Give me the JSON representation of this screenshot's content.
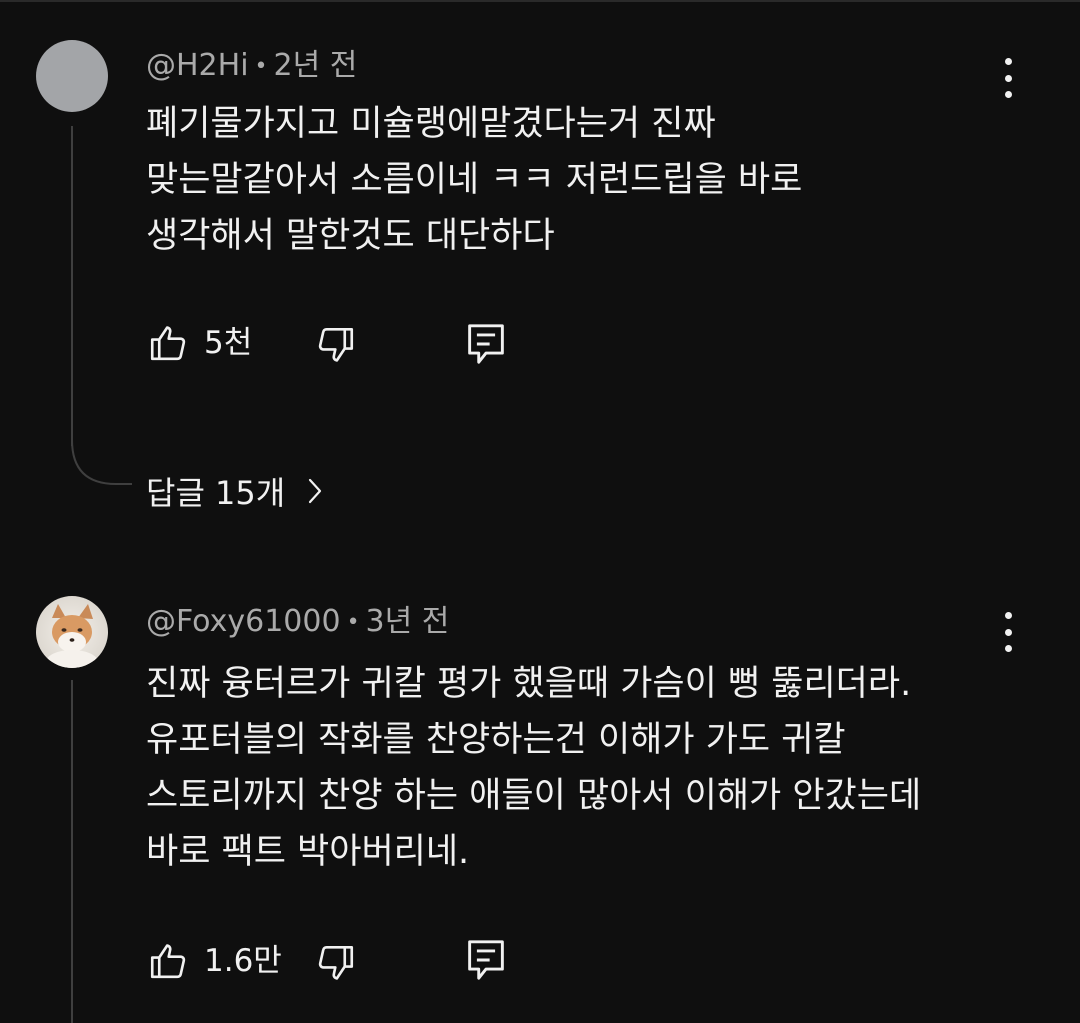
{
  "comments": [
    {
      "author": "@H2Hi",
      "separator": "•",
      "time": "2년 전",
      "lines": [
        "폐기물가지고 미슐랭에맡겼다는거 진짜",
        "맞는말같아서 소름이네 ㅋㅋ 저런드립을 바로",
        "생각해서 말한것도 대단하다"
      ],
      "like_count": "5천",
      "replies_label": "답글 15개",
      "avatar": "gray-circle"
    },
    {
      "author": "@Foxy61000",
      "separator": "•",
      "time": "3년 전",
      "lines": [
        "진짜 융터르가 귀칼 평가 했을때 가슴이 뻥 뚫리더라.",
        "유포터블의 작화를 찬양하는건 이해가 가도 귀칼",
        "스토리까지 찬양 하는 애들이 많아서 이해가 안갔는데",
        "바로 팩트 박아버리네."
      ],
      "like_count": "1.6만",
      "avatar": "fox-photo"
    }
  ],
  "icons": {
    "like": "thumbs-up-icon",
    "dislike": "thumbs-down-icon",
    "reply": "reply-comment-icon",
    "more": "more-vertical-icon",
    "chevron": "chevron-right-icon"
  },
  "colors": {
    "background": "#0f0f0f",
    "text": "#f1f1f1",
    "meta": "#aaaaaa",
    "thread": "#3f3f3f"
  }
}
